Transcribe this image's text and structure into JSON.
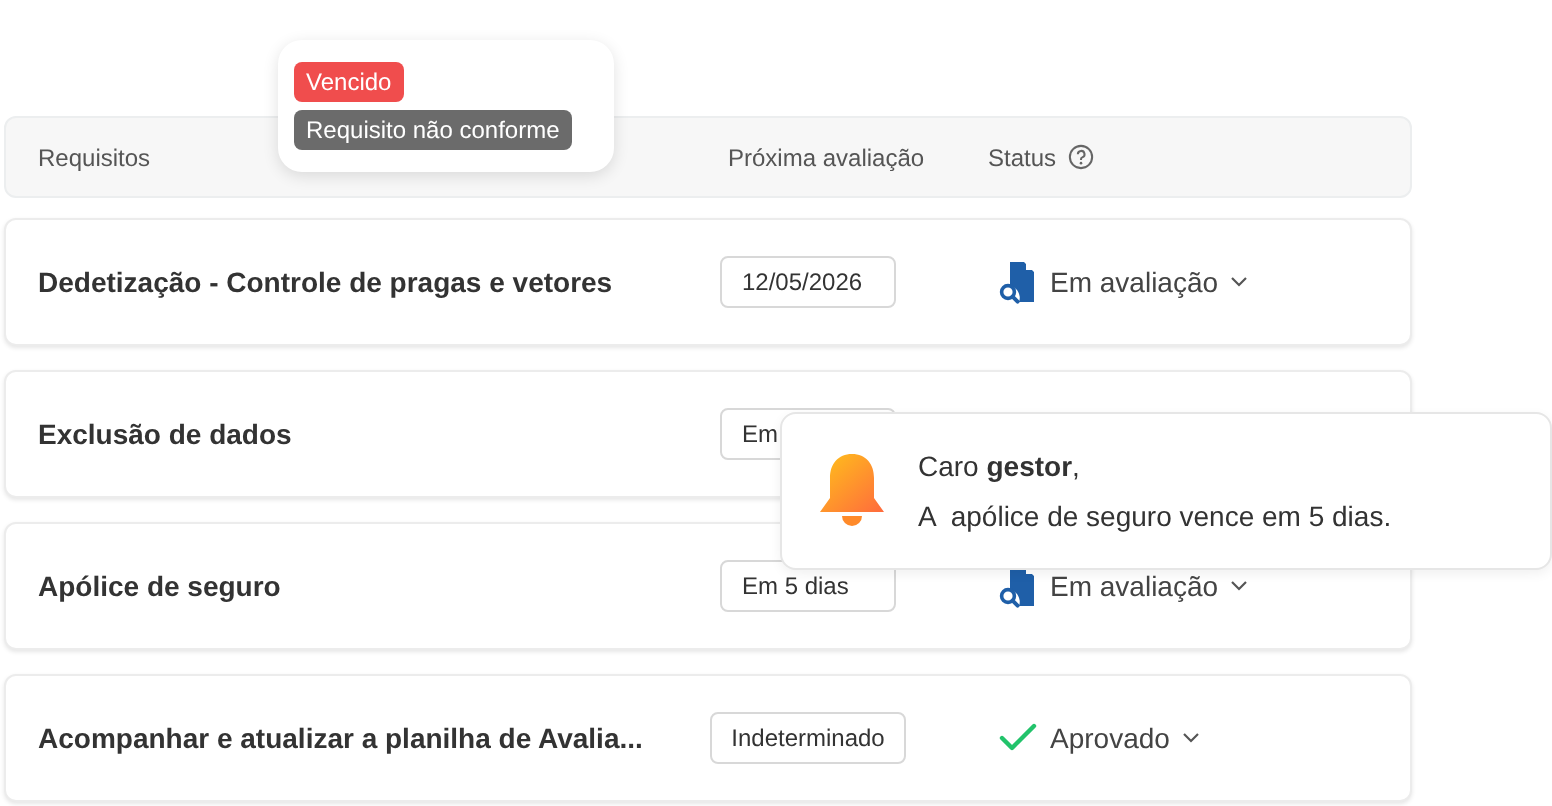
{
  "table": {
    "columns": [
      "Requisitos",
      "Próxima avaliação",
      "Status"
    ],
    "rows": [
      {
        "name": "Dedetização - Controle de pragas e vetores",
        "date": "12/05/2026",
        "status": {
          "kind": "review",
          "label": "Em avaliação"
        }
      },
      {
        "name": "Exclusão de dados",
        "date": "Em"
      },
      {
        "name": "Apólice de seguro",
        "date": "Em 5 dias",
        "status": {
          "kind": "review",
          "label": "Em avaliação"
        }
      },
      {
        "name": "Acompanhar e atualizar a planilha de Avalia...",
        "date": "Indeterminado",
        "status": {
          "kind": "approved",
          "label": "Aprovado"
        }
      }
    ]
  },
  "legend": {
    "badges": [
      {
        "label": "Vencido",
        "color": "#f04d4d"
      },
      {
        "label": "Requisito não conforme",
        "color": "#6b6b6b"
      }
    ]
  },
  "notification": {
    "greeting": "Caro **gestor**,",
    "message": "A  apólice de seguro vence em 5 dias."
  }
}
